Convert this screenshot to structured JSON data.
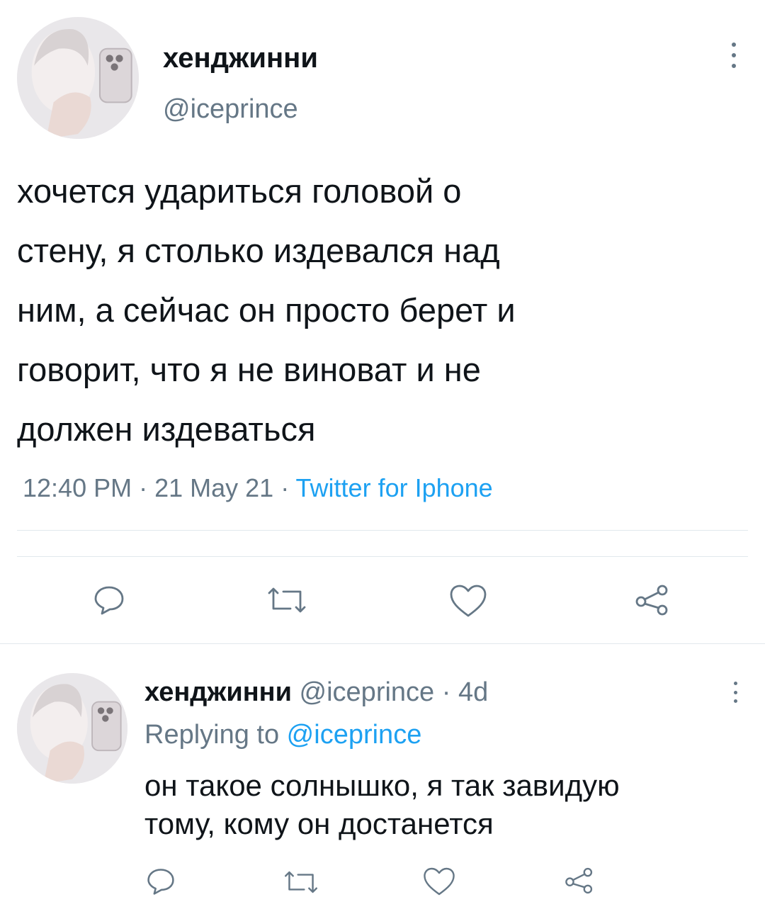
{
  "tweet": {
    "author_name": "хенджинни",
    "author_handle": "@iceprince",
    "text": "хочется удариться головой о\nстену, я столько издевался над\nним, а сейчас он просто берет и\nговорит, что я не виноват и не\nдолжен издеваться",
    "time": "12:40 PM",
    "sep1": " · ",
    "date": "21 May 21",
    "sep2": " · ",
    "source": "Twitter for Iphone"
  },
  "reply": {
    "author_name": "хенджинни",
    "author_handle": "@iceprince",
    "sep": " · ",
    "age": "4d",
    "replying_to_label": "Replying to ",
    "replying_to_handle": "@iceprince",
    "text": "он такое солнышко, я так завидую\nтому, кому он достанется"
  },
  "icons": {
    "reply": "reply-icon",
    "retweet": "retweet-icon",
    "like": "heart-icon",
    "share": "share-icon",
    "more": "more-vertical-icon"
  },
  "colors": {
    "text": "#0f1419",
    "muted": "#657786",
    "link": "#1da1f2",
    "divider": "#e1e8ed"
  }
}
